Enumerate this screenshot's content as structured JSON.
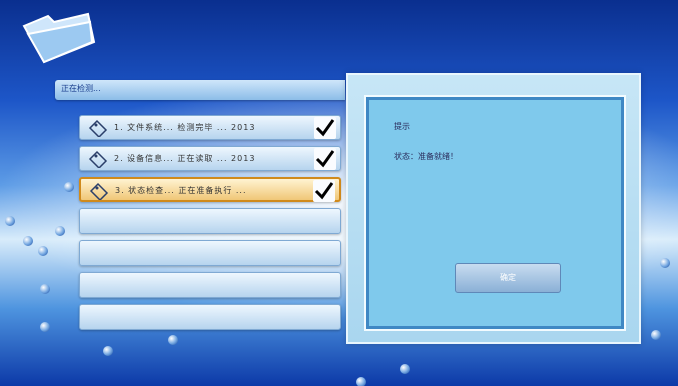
{
  "header": {
    "tab_label": "正在检测..."
  },
  "list": {
    "items": [
      {
        "label": "1. 文件系统... 检测完毕 ... 2013",
        "checked": true,
        "highlighted": false
      },
      {
        "label": "2. 设备信息... 正在读取 ... 2013",
        "checked": true,
        "highlighted": false
      },
      {
        "label": "3. 状态检查... 正在准备执行 ...",
        "checked": true,
        "highlighted": true
      },
      {
        "label": "",
        "checked": false,
        "highlighted": false
      },
      {
        "label": "",
        "checked": false,
        "highlighted": false
      },
      {
        "label": "",
        "checked": false,
        "highlighted": false
      },
      {
        "label": "",
        "checked": false,
        "highlighted": false
      }
    ]
  },
  "panel": {
    "title": "提示",
    "status": "状态：准备就绪！",
    "ok_label": "确定"
  },
  "colors": {
    "highlight_border": "#d08a1c",
    "panel_inner": "#7fc9ec",
    "checkmark": "#000000"
  },
  "icons": {
    "folder": "folder-icon",
    "row": "tag-icon",
    "check": "checkmark-icon"
  }
}
